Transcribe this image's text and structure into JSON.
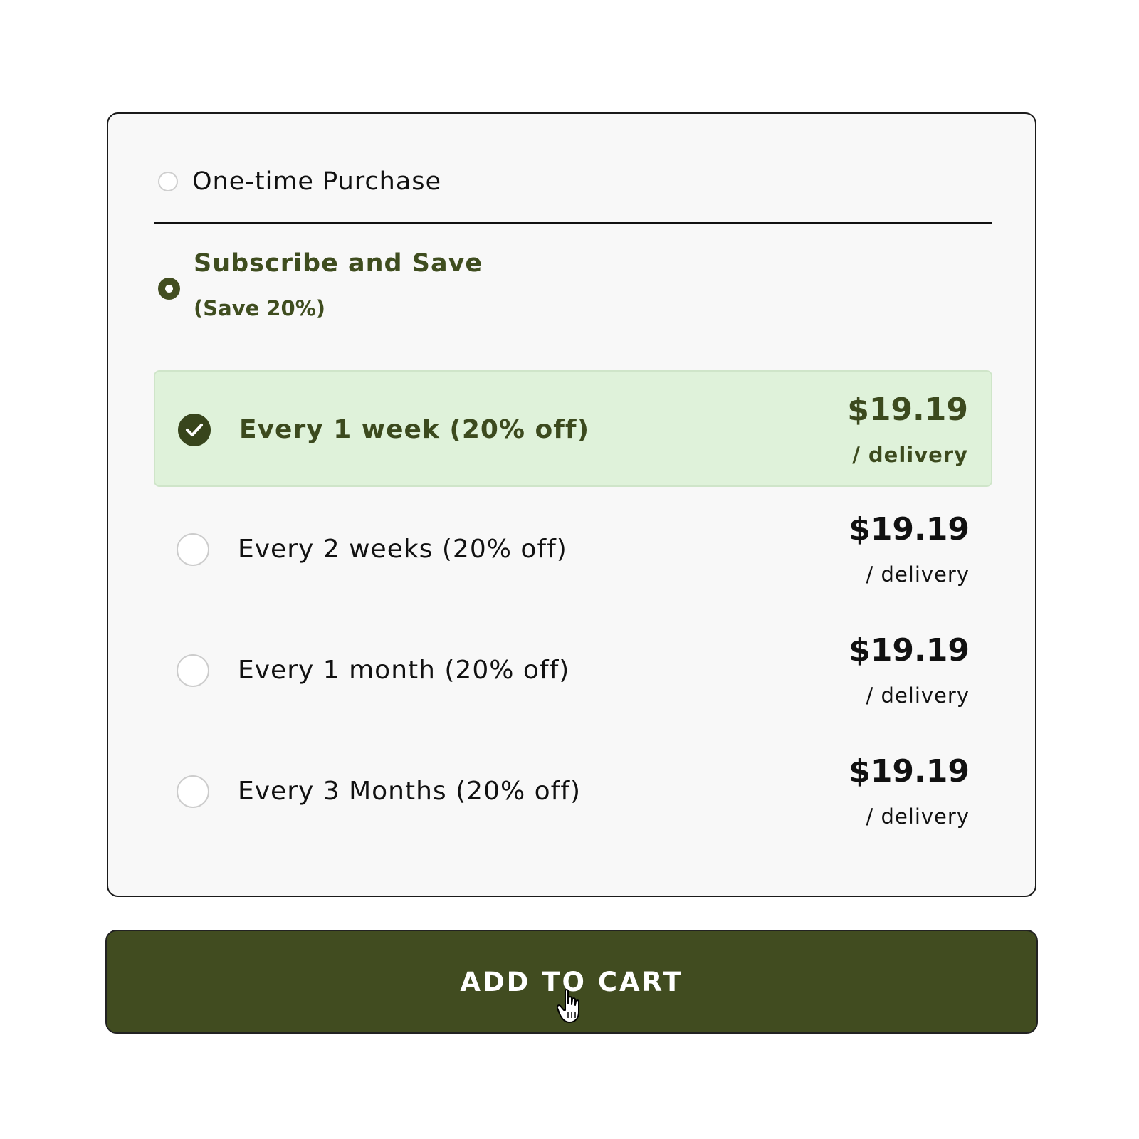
{
  "purchase_options": {
    "one_time_label": "One-time Purchase",
    "subscribe_label": "Subscribe and Save",
    "subscribe_discount": "(Save 20%)"
  },
  "frequencies": [
    {
      "label": "Every 1 week (20% off)",
      "price": "$19.19",
      "per": "/ delivery",
      "selected": true
    },
    {
      "label": "Every 2 weeks (20% off)",
      "price": "$19.19",
      "per": "/ delivery",
      "selected": false
    },
    {
      "label": "Every 1 month (20% off)",
      "price": "$19.19",
      "per": "/ delivery",
      "selected": false
    },
    {
      "label": "Every 3 Months (20% off)",
      "price": "$19.19",
      "per": "/ delivery",
      "selected": false
    }
  ],
  "cart_button": {
    "label": "ADD TO CART"
  },
  "icons": {
    "selected_option": "checkmark-circle-icon",
    "cursor": "hand-pointer-icon"
  },
  "colors": {
    "brand_green": "#414c20",
    "selected_bg": "#dff2da",
    "panel_bg": "#f8f8f8"
  }
}
